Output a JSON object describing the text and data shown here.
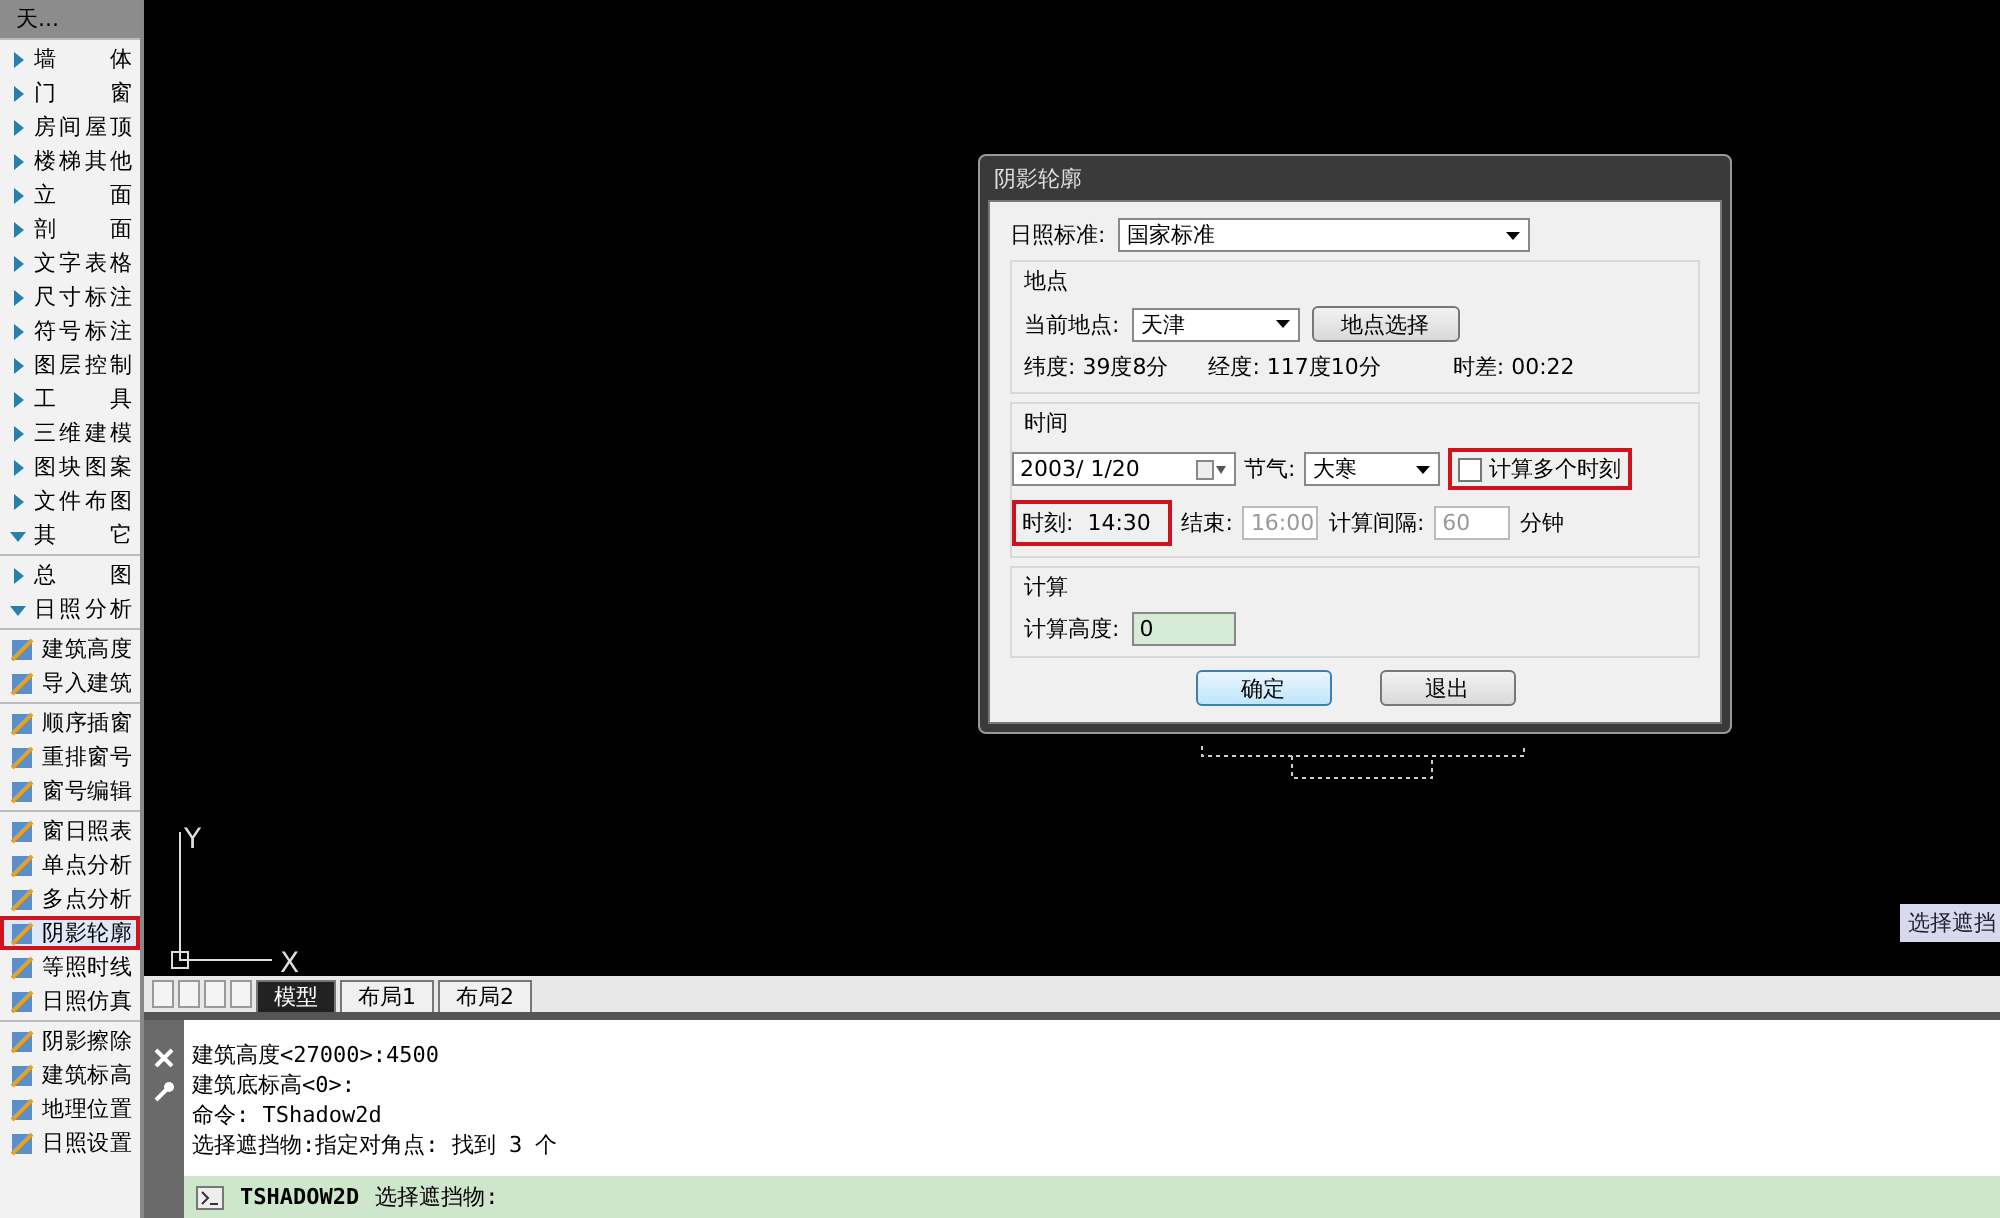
{
  "sidebar": {
    "title": "天...",
    "groups": [
      {
        "items": [
          {
            "kind": "folder",
            "label": "墙 体",
            "expanded": false
          },
          {
            "kind": "folder",
            "label": "门 窗",
            "expanded": false
          },
          {
            "kind": "folder",
            "label": "房间屋顶",
            "expanded": false
          },
          {
            "kind": "folder",
            "label": "楼梯其他",
            "expanded": false
          },
          {
            "kind": "folder",
            "label": "立 面",
            "expanded": false
          },
          {
            "kind": "folder",
            "label": "剖 面",
            "expanded": false
          },
          {
            "kind": "folder",
            "label": "文字表格",
            "expanded": false
          },
          {
            "kind": "folder",
            "label": "尺寸标注",
            "expanded": false
          },
          {
            "kind": "folder",
            "label": "符号标注",
            "expanded": false
          },
          {
            "kind": "folder",
            "label": "图层控制",
            "expanded": false
          },
          {
            "kind": "folder",
            "label": "工 具",
            "expanded": false
          },
          {
            "kind": "folder",
            "label": "三维建模",
            "expanded": false
          },
          {
            "kind": "folder",
            "label": "图块图案",
            "expanded": false
          },
          {
            "kind": "folder",
            "label": "文件布图",
            "expanded": false
          },
          {
            "kind": "folder",
            "label": "其 它",
            "expanded": true
          }
        ]
      },
      {
        "items": [
          {
            "kind": "folder",
            "label": "总 图",
            "expanded": false
          },
          {
            "kind": "folder",
            "label": "日照分析",
            "expanded": true
          }
        ]
      },
      {
        "items": [
          {
            "kind": "tool",
            "label": "建筑高度",
            "selected": false
          },
          {
            "kind": "tool",
            "label": "导入建筑",
            "selected": false
          }
        ]
      },
      {
        "items": [
          {
            "kind": "tool",
            "label": "顺序插窗",
            "selected": false
          },
          {
            "kind": "tool",
            "label": "重排窗号",
            "selected": false
          },
          {
            "kind": "tool",
            "label": "窗号编辑",
            "selected": false
          }
        ]
      },
      {
        "items": [
          {
            "kind": "tool",
            "label": "窗日照表",
            "selected": false
          },
          {
            "kind": "tool",
            "label": "单点分析",
            "selected": false
          },
          {
            "kind": "tool",
            "label": "多点分析",
            "selected": false
          },
          {
            "kind": "tool",
            "label": "阴影轮廓",
            "selected": true
          },
          {
            "kind": "tool",
            "label": "等照时线",
            "selected": false
          },
          {
            "kind": "tool",
            "label": "日照仿真",
            "selected": false
          }
        ]
      },
      {
        "items": [
          {
            "kind": "tool",
            "label": "阴影擦除",
            "selected": false
          },
          {
            "kind": "tool",
            "label": "建筑标高",
            "selected": false
          },
          {
            "kind": "tool",
            "label": "地理位置",
            "selected": false
          },
          {
            "kind": "tool",
            "label": "日照设置",
            "selected": false
          }
        ]
      }
    ]
  },
  "canvas": {
    "tooltip": "选择遮挡",
    "axis_x": "X",
    "axis_y": "Y"
  },
  "dialog": {
    "title": "阴影轮廓",
    "standard_label": "日照标准:",
    "standard_value": "国家标准",
    "location": {
      "heading": "地点",
      "current_label": "当前地点:",
      "current_value": "天津",
      "select_button": "地点选择",
      "latitude": "纬度: 39度8分",
      "longitude": "经度: 117度10分",
      "time_diff": "时差:  00:22"
    },
    "time": {
      "heading": "时间",
      "date": "2003/ 1/20",
      "term_label": "节气:",
      "term_value": "大寒",
      "multi_checkbox": {
        "label": "计算多个时刻",
        "checked": false,
        "highlighted": true
      },
      "moment": {
        "label": "时刻:",
        "value": "14:30",
        "highlighted": true
      },
      "end_label": "结束:",
      "end_value": "16:00",
      "interval_label": "计算间隔:",
      "interval_value": "60",
      "interval_unit": "分钟"
    },
    "calc": {
      "heading": "计算",
      "height_label": "计算高度:",
      "height_value": "0"
    },
    "buttons": [
      {
        "label": "确定",
        "default": true
      },
      {
        "label": "退出",
        "default": false
      }
    ]
  },
  "layout_tabs": [
    {
      "label": "模型",
      "selected": true
    },
    {
      "label": "布局1",
      "selected": false
    },
    {
      "label": "布局2",
      "selected": false
    }
  ],
  "command_history": [
    "建筑高度<27000>:4500",
    "建筑底标高<0>:",
    "命令: TShadow2d",
    "选择遮挡物:指定对角点: 找到 3 个"
  ],
  "command_line": {
    "command": "TSHADOW2D",
    "prompt": "选择遮挡物:"
  }
}
